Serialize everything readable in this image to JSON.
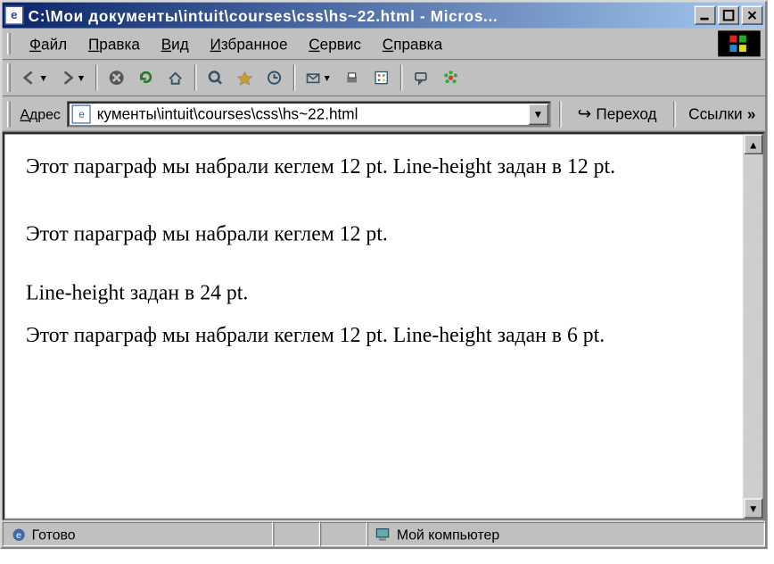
{
  "titlebar": {
    "title": "C:\\Мои документы\\intuit\\courses\\css\\hs~22.html - Micros..."
  },
  "menu": {
    "file": "Файл",
    "edit": "Правка",
    "view": "Вид",
    "favorites": "Избранное",
    "tools": "Сервис",
    "help": "Справка"
  },
  "address": {
    "label": "Адрес",
    "value": "кументы\\intuit\\courses\\css\\hs~22.html",
    "go": "Переход",
    "links": "Ссылки"
  },
  "content": {
    "p1": "Этот параграф мы набрали кеглем 12 pt. Line-height задан в 12 pt.",
    "p2": "Этот параграф мы набрали кеглем 12 pt.",
    "p3": "Line-height задан в 24 pt.",
    "p4": "Этот параграф мы набрали кеглем 12 pt. Line-height задан в 6 pt."
  },
  "status": {
    "ready": "Готово",
    "zone": "Мой компьютер"
  }
}
